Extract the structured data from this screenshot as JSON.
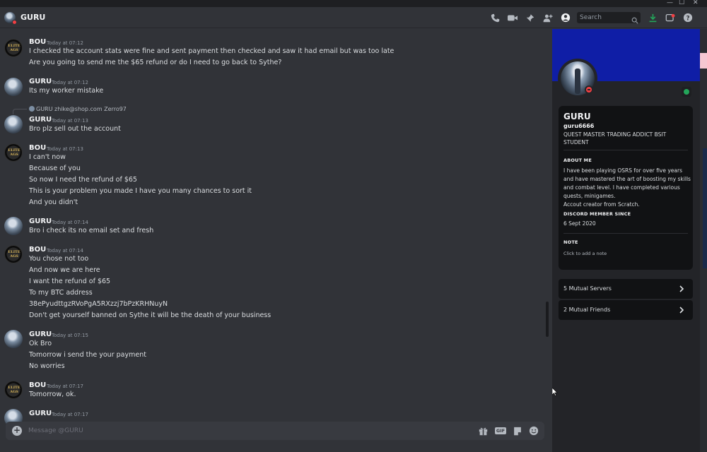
{
  "window_controls": [
    "—",
    "☐",
    "✕"
  ],
  "header": {
    "title": "GURU",
    "search_placeholder": "Search",
    "icons": [
      "call-icon",
      "video-icon",
      "pin-icon",
      "add-friend-icon",
      "profile-toggle-icon",
      "search-icon",
      "download-icon",
      "inbox-icon",
      "help-icon"
    ]
  },
  "messages": [
    {
      "author": "BOU",
      "time": "Today at 07:12",
      "lines": [
        "I checked the account stats were fine and sent payment then checked and saw it had email but was too late",
        "Are you going to send me the $65 refund or do I need to go back to Sythe?"
      ]
    },
    {
      "author": "GURU",
      "time": "Today at 07:12",
      "lines": [
        "Its my worker mistake"
      ]
    },
    {
      "author": "GURU",
      "time": "Today at 07:13",
      "reply": "GURU zhike@shop.com Zerro97",
      "lines": [
        "Bro plz sell out the account"
      ]
    },
    {
      "author": "BOU",
      "time": "Today at 07:13",
      "lines": [
        "I can't now",
        "Because of you",
        "So now I need the refund of $65",
        "This is your problem you made I have you many chances to sort it",
        "And you didn't"
      ]
    },
    {
      "author": "GURU",
      "time": "Today at 07:14",
      "lines": [
        "Bro i check its no email set and fresh"
      ]
    },
    {
      "author": "BOU",
      "time": "Today at 07:14",
      "lines": [
        "You chose not too",
        "And now we are here",
        "I want the refund of $65",
        "To my BTC address",
        "38ePyudttgzRVoPgA5RXzzj7bPzKRHNuyN",
        "Don't get yourself banned on Sythe it will be the death of your business"
      ]
    },
    {
      "author": "GURU",
      "time": "Today at 07:15",
      "lines": [
        "Ok Bro",
        "Tomorrow i send the your payment",
        "No worries"
      ]
    },
    {
      "author": "BOU",
      "time": "Today at 07:17",
      "lines": [
        "Tomorrow, ok."
      ]
    },
    {
      "author": "GURU",
      "time": "Today at 07:17",
      "lines": []
    }
  ],
  "avatar_badge_text": "ELITE AGS",
  "composer": {
    "placeholder": "Message @GURU",
    "icons": [
      "add-attachment-icon",
      "gift-icon",
      "gif-icon",
      "sticker-icon",
      "emoji-icon"
    ],
    "gif_label": "GIF"
  },
  "profile": {
    "name": "GURU",
    "handle": "guru6666",
    "bio": "QUEST MASTER TRADING ADDICT BSIT STUDENT",
    "about_title": "ABOUT ME",
    "about": "I have been playing OSRS for over five years and have mastered the art of boosting my skills and combat level. I have completed various quests, minigames.\nAccout creator from Scratch.",
    "member_since_title": "DISCORD MEMBER SINCE",
    "member_since": "6 Sept 2020",
    "note_title": "NOTE",
    "note_placeholder": "Click to add a note",
    "mutual_servers": "5 Mutual Servers",
    "mutual_friends": "2 Mutual Friends",
    "banner_color": "#0f1ea6",
    "status": "dnd"
  },
  "colors": {
    "background": "#313338",
    "panel": "#232428",
    "status_red": "#f23f43",
    "accent_green": "#23a55a"
  }
}
